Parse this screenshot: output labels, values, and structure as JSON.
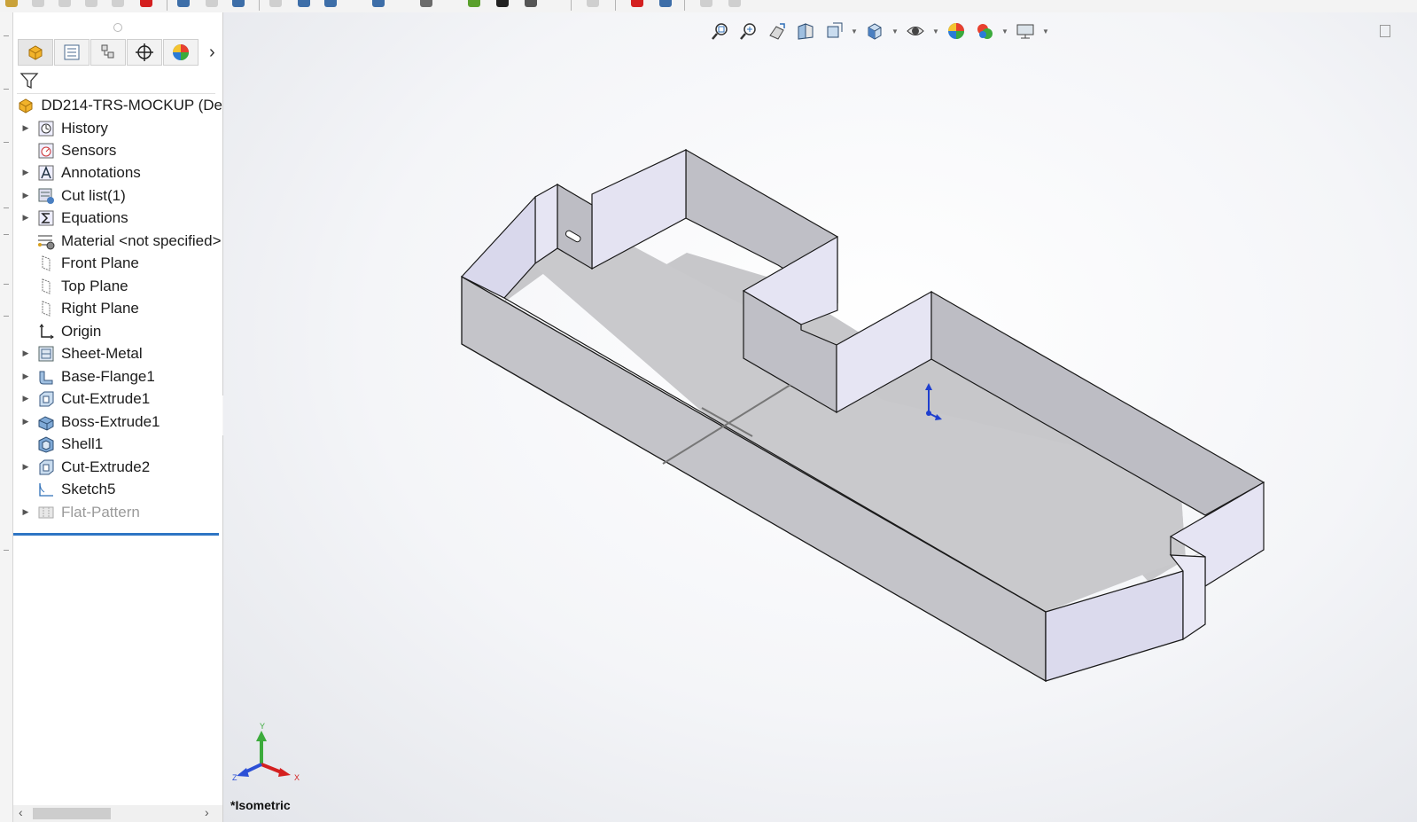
{
  "feature_tree": {
    "root_label": "DD214-TRS-MOCKUP  (De",
    "items": [
      {
        "label": "History",
        "icon": "history-icon",
        "expandable": true
      },
      {
        "label": "Sensors",
        "icon": "sensors-icon",
        "expandable": false
      },
      {
        "label": "Annotations",
        "icon": "annotations-icon",
        "expandable": true
      },
      {
        "label": "Cut list(1)",
        "icon": "cut-list-icon",
        "expandable": true
      },
      {
        "label": "Equations",
        "icon": "equations-icon",
        "expandable": true
      },
      {
        "label": "Material <not specified>",
        "icon": "material-icon",
        "expandable": false
      },
      {
        "label": "Front Plane",
        "icon": "plane-icon",
        "expandable": false
      },
      {
        "label": "Top Plane",
        "icon": "plane-icon",
        "expandable": false
      },
      {
        "label": "Right Plane",
        "icon": "plane-icon",
        "expandable": false
      },
      {
        "label": "Origin",
        "icon": "origin-icon",
        "expandable": false
      },
      {
        "label": "Sheet-Metal",
        "icon": "sheet-metal-icon",
        "expandable": true
      },
      {
        "label": "Base-Flange1",
        "icon": "base-flange-icon",
        "expandable": true
      },
      {
        "label": "Cut-Extrude1",
        "icon": "cut-extrude-icon",
        "expandable": true
      },
      {
        "label": "Boss-Extrude1",
        "icon": "boss-extrude-icon",
        "expandable": true
      },
      {
        "label": "Shell1",
        "icon": "shell-icon",
        "expandable": false
      },
      {
        "label": "Cut-Extrude2",
        "icon": "cut-extrude-icon",
        "expandable": true
      },
      {
        "label": "Sketch5",
        "icon": "sketch-icon",
        "expandable": false
      },
      {
        "label": "Flat-Pattern",
        "icon": "flat-pattern-icon",
        "expandable": true,
        "suppressed": true
      }
    ]
  },
  "panel_tabs": [
    {
      "name": "feature-manager-tab",
      "icon": "part-icon"
    },
    {
      "name": "property-manager-tab",
      "icon": "property-list-icon"
    },
    {
      "name": "configuration-manager-tab",
      "icon": "configuration-icon"
    },
    {
      "name": "dimxpert-manager-tab",
      "icon": "crosshair-icon"
    },
    {
      "name": "display-manager-tab",
      "icon": "appearance-sphere-icon"
    }
  ],
  "viewport": {
    "view_label": "*Isometric",
    "triad_labels": {
      "x": "X",
      "y": "Y",
      "z": "Z"
    }
  },
  "colors": {
    "accent": "#2e75c4",
    "model_face_light": "#e4e3f2",
    "model_face_dark": "#bebec4",
    "model_floor": "#c9c9cc",
    "edge": "#1a1a1a"
  }
}
